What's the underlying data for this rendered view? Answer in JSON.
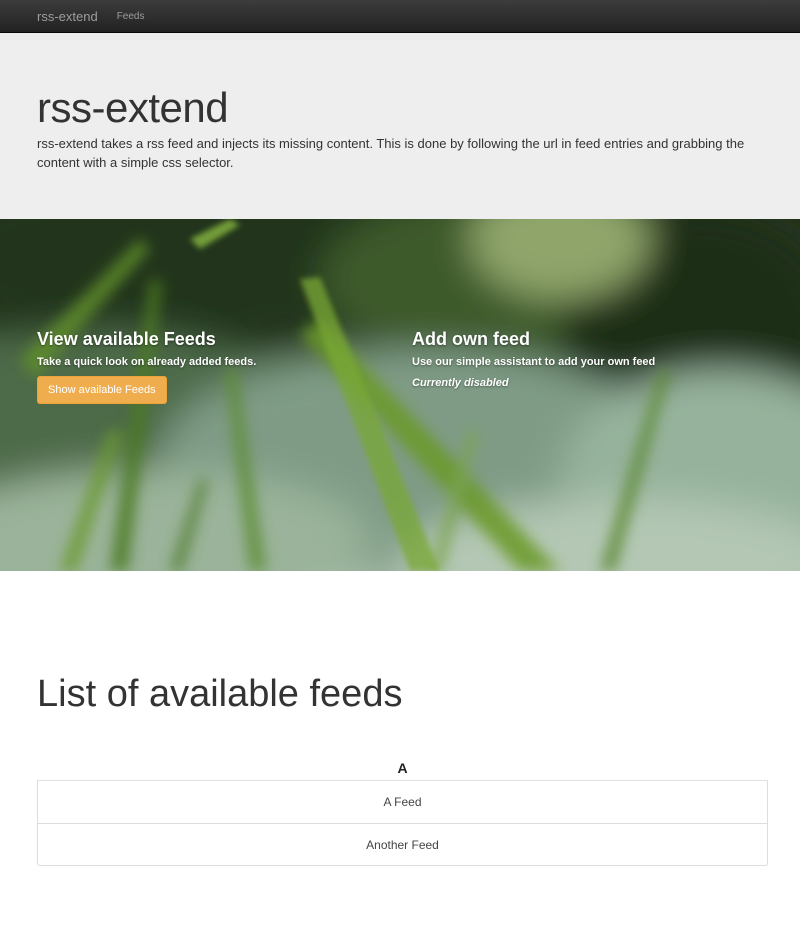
{
  "navbar": {
    "brand": "rss-extend",
    "links": [
      "Feeds"
    ]
  },
  "jumbotron": {
    "title": "rss-extend",
    "description": "rss-extend takes a rss feed and injects its missing content. This is done by following the url in feed entries and grabbing the content with a simple css selector."
  },
  "hero": {
    "left": {
      "title": "View available Feeds",
      "subtitle": "Take a quick look on already added feeds.",
      "button_label": "Show available Feeds"
    },
    "right": {
      "title": "Add own feed",
      "subtitle": "Use our simple assistant to add your own feed",
      "note": "Currently disabled"
    }
  },
  "feeds_section": {
    "title": "List of available feeds",
    "groups": [
      {
        "letter": "A",
        "items": [
          "A Feed",
          "Another Feed"
        ]
      }
    ]
  },
  "colors": {
    "navbar": "#222222",
    "jumbotron": "#eeeeee",
    "button_warning": "#f0ad4e"
  }
}
